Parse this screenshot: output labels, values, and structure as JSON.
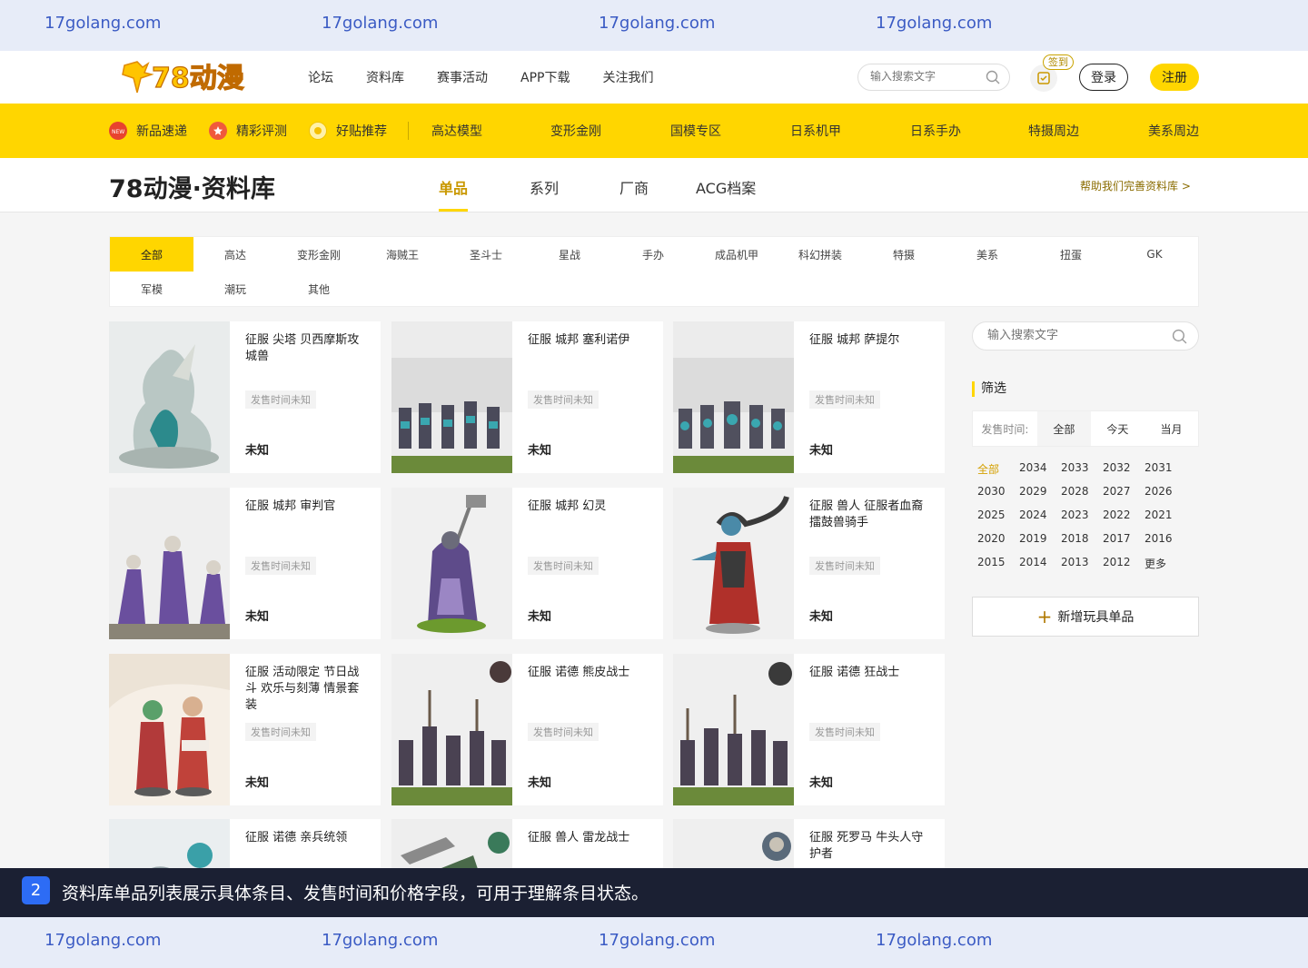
{
  "watermarks": [
    "17golang.com",
    "17golang.com",
    "17golang.com",
    "17golang.com"
  ],
  "header": {
    "logo_text": "78动漫",
    "nav": [
      "论坛",
      "资料库",
      "赛事活动",
      "APP下载",
      "关注我们"
    ],
    "search_placeholder": "输入搜索文字",
    "checkin_label": "签到",
    "login_label": "登录",
    "register_label": "注册"
  },
  "category_bar": {
    "featured": [
      {
        "label": "新品速递",
        "icon": "new-badge-icon"
      },
      {
        "label": "精彩评测",
        "icon": "star-badge-icon"
      },
      {
        "label": "好贴推荐",
        "icon": "thumb-badge-icon"
      }
    ],
    "categories": [
      "高达模型",
      "变形金刚",
      "国模专区",
      "日系机甲",
      "日系手办",
      "特摄周边",
      "美系周边"
    ]
  },
  "subheader": {
    "title": "78动漫·资料库",
    "tabs": [
      "单品",
      "系列",
      "厂商",
      "ACG档案"
    ],
    "active_tab": "单品",
    "help_link": "帮助我们完善资料库 >"
  },
  "filters": [
    "全部",
    "高达",
    "变形金刚",
    "海贼王",
    "圣斗士",
    "星战",
    "手办",
    "成品机甲",
    "科幻拼装",
    "特摄",
    "美系",
    "扭蛋",
    "GK",
    "军模",
    "潮玩",
    "其他"
  ],
  "active_filter": "全部",
  "products": [
    {
      "name": "征服 尖塔 贝西摩斯攻城兽",
      "date": "发售时间未知",
      "price": "未知"
    },
    {
      "name": "征服 城邦 塞利诺伊",
      "date": "发售时间未知",
      "price": "未知"
    },
    {
      "name": "征服 城邦 萨提尔",
      "date": "发售时间未知",
      "price": "未知"
    },
    {
      "name": "征服 城邦 审判官",
      "date": "发售时间未知",
      "price": "未知"
    },
    {
      "name": "征服 城邦 幻灵",
      "date": "发售时间未知",
      "price": "未知"
    },
    {
      "name": "征服 兽人 征服者血裔擂鼓兽骑手",
      "date": "发售时间未知",
      "price": "未知"
    },
    {
      "name": "征服 活动限定 节日战斗 欢乐与刻薄 情景套装",
      "date": "发售时间未知",
      "price": "未知"
    },
    {
      "name": "征服 诺德 熊皮战士",
      "date": "发售时间未知",
      "price": "未知"
    },
    {
      "name": "征服 诺德 狂战士",
      "date": "发售时间未知",
      "price": "未知"
    },
    {
      "name": "征服 诺德 亲兵统领",
      "date": "",
      "price": ""
    },
    {
      "name": "征服 兽人 雷龙战士",
      "date": "",
      "price": ""
    },
    {
      "name": "征服 死罗马 牛头人守护者",
      "date": "",
      "price": ""
    }
  ],
  "sidebar": {
    "search_placeholder": "输入搜索文字",
    "screen_title": "筛选",
    "time_label": "发售时间:",
    "time_tabs": [
      "全部",
      "今天",
      "当月"
    ],
    "years": [
      "全部",
      "2034",
      "2033",
      "2032",
      "2031",
      "2030",
      "2029",
      "2028",
      "2027",
      "2026",
      "2025",
      "2024",
      "2023",
      "2022",
      "2021",
      "2020",
      "2019",
      "2018",
      "2017",
      "2016",
      "2015",
      "2014",
      "2013",
      "2012",
      "更多"
    ],
    "add_button": "新增玩具单品"
  },
  "caption": {
    "step": "2",
    "text": "资料库单品列表展示具体条目、发售时间和价格字段，可用于理解条目状态。"
  },
  "colors": {
    "brand_yellow": "#ffd600",
    "caption_bg": "#1b2033",
    "step_blue": "#2d6cf5",
    "watermark": "#3b5bc4"
  }
}
